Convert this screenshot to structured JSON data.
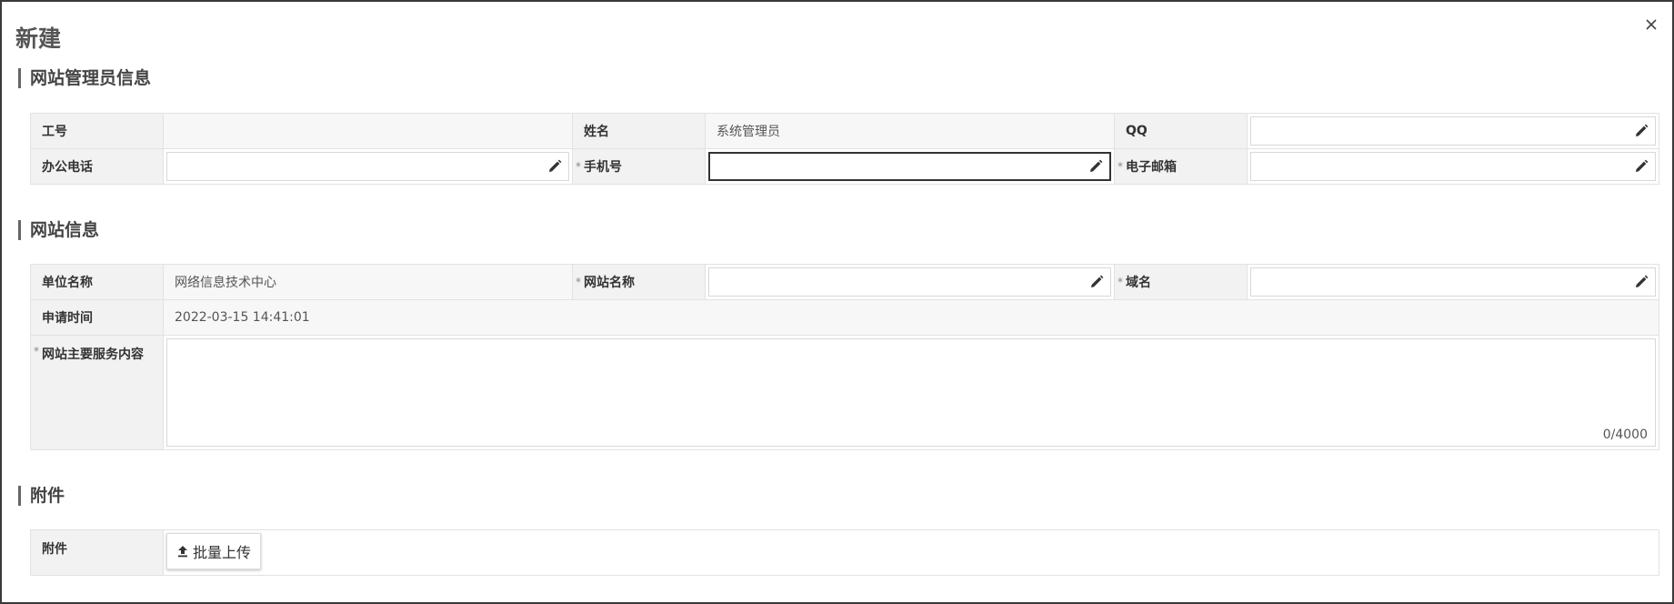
{
  "dialog": {
    "title": "新建"
  },
  "sections": {
    "admin": "网站管理员信息",
    "site": "网站信息",
    "attachment": "附件"
  },
  "admin_form": {
    "employee_id": {
      "label": "工号",
      "value": ""
    },
    "name": {
      "label": "姓名",
      "value": "系统管理员"
    },
    "qq": {
      "label": "QQ",
      "value": ""
    },
    "office_phone": {
      "label": "办公电话",
      "value": ""
    },
    "mobile": {
      "label": "手机号",
      "required_mark": "*",
      "value": ""
    },
    "email": {
      "label": "电子邮箱",
      "required_mark": "*",
      "value": ""
    }
  },
  "site_form": {
    "unit_name": {
      "label": "单位名称",
      "value": "网络信息技术中心"
    },
    "site_name": {
      "label": "网站名称",
      "required_mark": "*",
      "value": ""
    },
    "domain": {
      "label": "域名",
      "required_mark": "*",
      "value": ""
    },
    "apply_time": {
      "label": "申请时间",
      "value": "2022-03-15 14:41:01"
    },
    "service_content": {
      "label": "网站主要服务内容",
      "required_mark": "*",
      "value": "",
      "counter": "0/4000"
    }
  },
  "attachment_form": {
    "label": "附件",
    "upload_label": "批量上传"
  },
  "icons": {
    "close": "close-icon",
    "edit": "pencil-icon",
    "upload": "upload-icon"
  }
}
